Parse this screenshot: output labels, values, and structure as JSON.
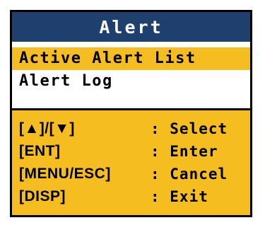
{
  "window": {
    "title": "Alert"
  },
  "menu": {
    "items": [
      {
        "label": "Active Alert List",
        "selected": true
      },
      {
        "label": "Alert Log",
        "selected": false
      }
    ]
  },
  "key_guide": [
    {
      "key": "[▲]/[▼]",
      "action": ": Select"
    },
    {
      "key": "[ENT]",
      "action": ": Enter"
    },
    {
      "key": "[MENU/ESC]",
      "action": ": Cancel"
    },
    {
      "key": "[DISP]",
      "action": ": Exit"
    }
  ],
  "colors": {
    "title_bar": "#1f3f6e",
    "highlight": "#f5bd1f",
    "text": "#000000",
    "background": "#ffffff"
  }
}
